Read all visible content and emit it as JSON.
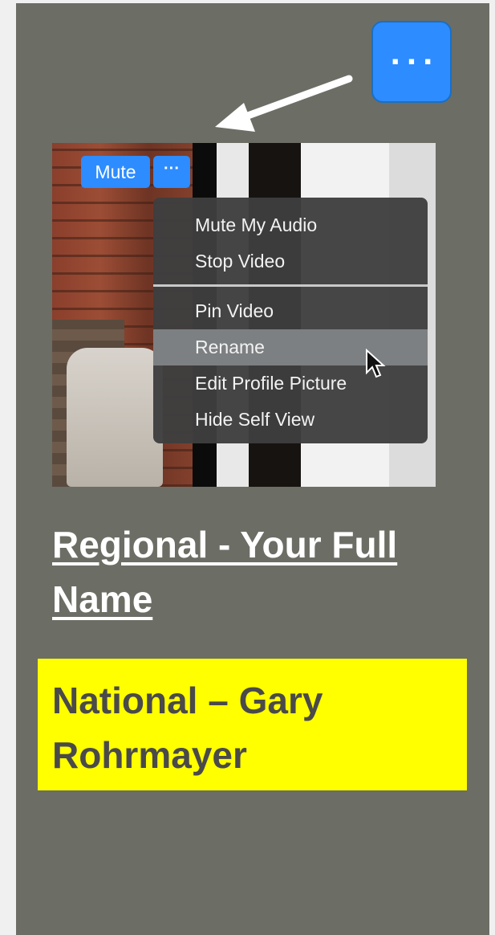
{
  "more_button": {
    "label": "..."
  },
  "screenshot": {
    "mute_label": "Mute",
    "dots_label": "···",
    "menu": {
      "items": [
        "Mute My Audio",
        "Stop Video",
        "Pin Video",
        "Rename",
        "Edit Profile Picture",
        "Hide Self View"
      ],
      "highlighted": "Rename"
    }
  },
  "heading": {
    "line1": "Regional - Your Full",
    "line2": "Name"
  },
  "national": {
    "line1": "National – Gary",
    "line2": "Rohrmayer"
  },
  "colors": {
    "slide_bg": "#6c6d65",
    "zoom_blue": "#2d8cff",
    "highlight_yellow": "#ffff00",
    "heading_text": "#ffffff",
    "national_text": "#4a4a4a"
  }
}
